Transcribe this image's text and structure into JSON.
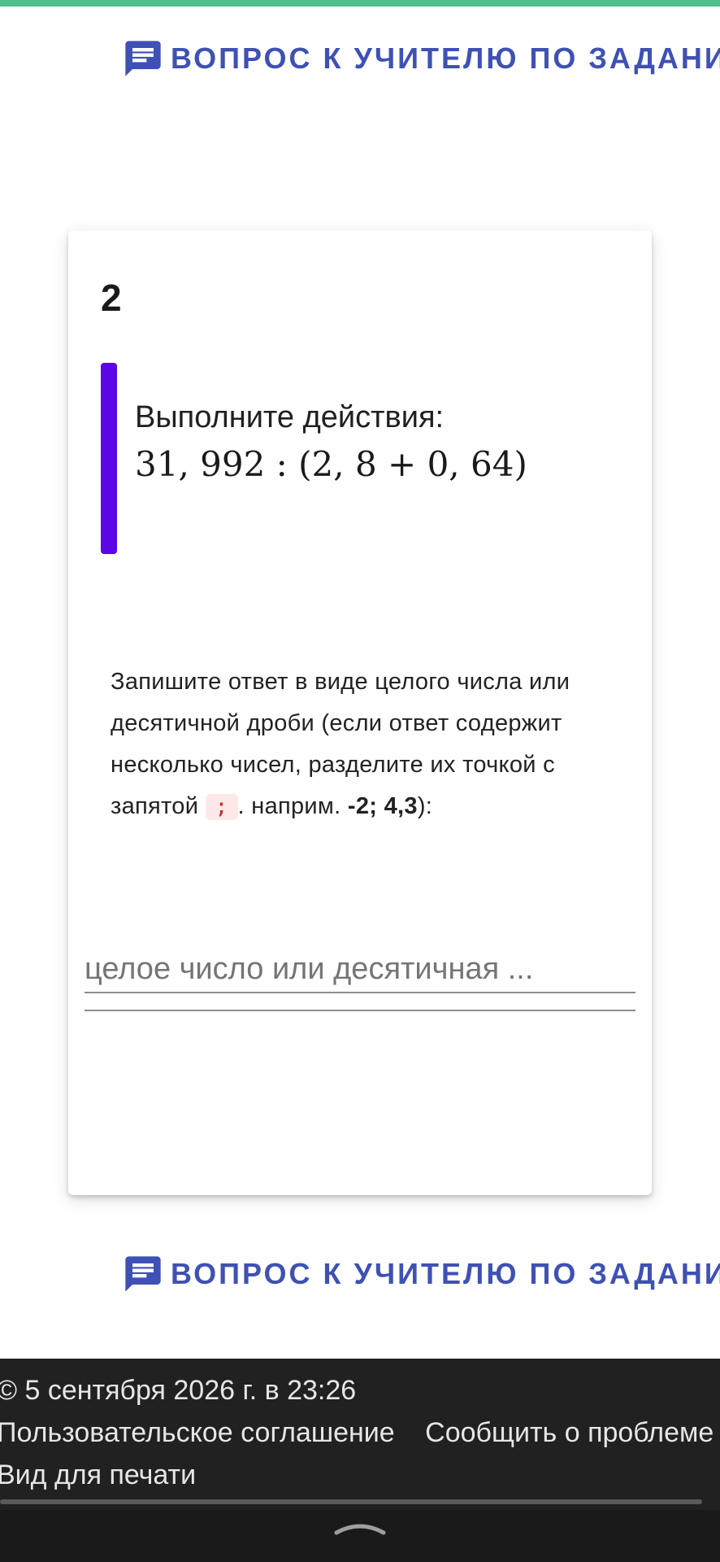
{
  "ask_teacher": {
    "label": "ВОПРОС К УЧИТЕЛЮ ПО ЗАДАНИЮ"
  },
  "task": {
    "number": "2",
    "title": "Выполните действия:",
    "formula": "31, 992 : (2, 8 + 0, 64)"
  },
  "instructions": {
    "text_before": "Запишите ответ в виде целого числа или десятичной дроби (если ответ содержит несколько чисел, разделите их точкой с запятой",
    "separator": ";",
    "text_example": ". наприм.",
    "example_part1": "-2;",
    "example_part2": "4,3",
    "text_after": "):"
  },
  "answer": {
    "placeholder": "целое число или десятичная ..."
  },
  "footer": {
    "copyright": "© 5 сентября 2026 г. в 23:26",
    "user_agreement": "Пользовательское соглашение",
    "report_problem": "Сообщить о проблеме",
    "print_view": "Вид для печати"
  },
  "colors": {
    "accent_purple": "#5b06e8",
    "link_blue": "#3f51b5",
    "top_bar": "#4fbf8b",
    "footer_bg": "#212121"
  }
}
